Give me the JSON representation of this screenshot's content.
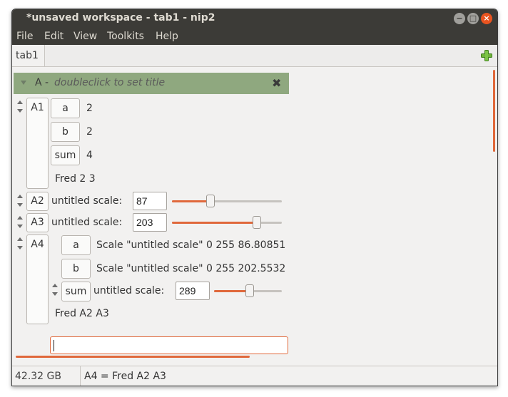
{
  "window": {
    "title": "*unsaved workspace - tab1 - nip2",
    "minimize": "−",
    "maximize": "□",
    "close": "×"
  },
  "menu": {
    "file": "File",
    "edit": "Edit",
    "view": "View",
    "toolkits": "Toolkits",
    "help": "Help"
  },
  "tabs": [
    {
      "label": "tab1"
    }
  ],
  "column": {
    "name": "A -",
    "subtitle": "doubleclick to set title",
    "close": "✖",
    "rows": {
      "A1": {
        "label": "A1",
        "a_label": "a",
        "a_value": "2",
        "b_label": "b",
        "b_value": "2",
        "sum_label": "sum",
        "sum_value": "4",
        "expr": "Fred 2 3"
      },
      "A2": {
        "label": "A2",
        "scale_label": "untitled scale:",
        "value": "87",
        "fraction": 0.341
      },
      "A3": {
        "label": "A3",
        "scale_label": "untitled scale:",
        "value": "203",
        "fraction": 0.796
      },
      "A4": {
        "label": "A4",
        "a_label": "a",
        "a_text": "Scale \"untitled scale\" 0 255 86.80851",
        "b_label": "b",
        "b_text": "Scale \"untitled scale\" 0 255 202.5532",
        "sum_label": "sum",
        "sum_scale_label": "untitled scale:",
        "sum_value": "289",
        "sum_fraction": 0.533,
        "expr": "Fred A2 A3"
      }
    },
    "command_input": ""
  },
  "status": {
    "free": "42.32 GB free",
    "message": "A4 = Fred A2 A3"
  },
  "colors": {
    "accent": "#e0683b",
    "column_header": "#8fa87f",
    "titlebar": "#3c3b37"
  },
  "icons": {
    "add_tab": "plus-icon",
    "close_column": "close-icon"
  }
}
